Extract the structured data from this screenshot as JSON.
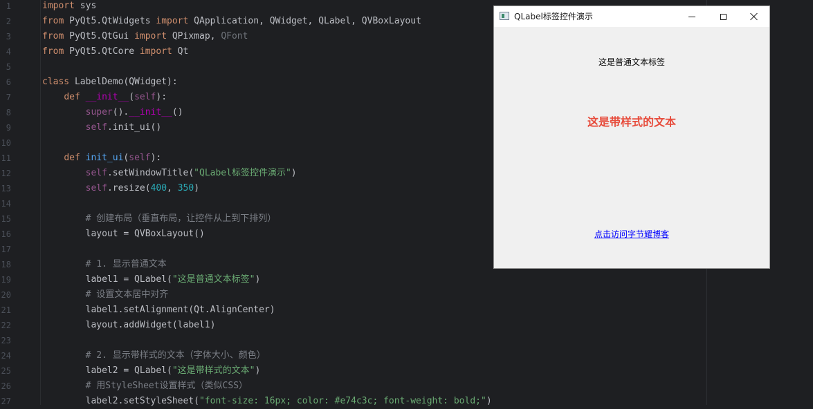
{
  "editor": {
    "lines": [
      {
        "n": "1",
        "tokens": [
          {
            "t": "import",
            "c": "kw"
          },
          {
            "t": " sys",
            "c": "plain"
          }
        ]
      },
      {
        "n": "2",
        "tokens": [
          {
            "t": "from",
            "c": "kw"
          },
          {
            "t": " PyQt5.QtWidgets ",
            "c": "plain"
          },
          {
            "t": "import",
            "c": "kw"
          },
          {
            "t": " QApplication, QWidget, QLabel, QVBoxLayout",
            "c": "plain"
          }
        ]
      },
      {
        "n": "3",
        "tokens": [
          {
            "t": "from",
            "c": "kw"
          },
          {
            "t": " PyQt5.QtGui ",
            "c": "plain"
          },
          {
            "t": "import",
            "c": "kw"
          },
          {
            "t": " QPixmap, ",
            "c": "plain"
          },
          {
            "t": "QFont",
            "c": "dim"
          }
        ]
      },
      {
        "n": "4",
        "tokens": [
          {
            "t": "from",
            "c": "kw"
          },
          {
            "t": " PyQt5.QtCore ",
            "c": "plain"
          },
          {
            "t": "import",
            "c": "kw"
          },
          {
            "t": " Qt",
            "c": "plain"
          }
        ]
      },
      {
        "n": "5",
        "tokens": []
      },
      {
        "n": "6",
        "tokens": [
          {
            "t": "class",
            "c": "kw"
          },
          {
            "t": " LabelDemo(QWidget):",
            "c": "plain"
          }
        ]
      },
      {
        "n": "7",
        "tokens": [
          {
            "t": "    ",
            "c": "plain"
          },
          {
            "t": "def",
            "c": "kw"
          },
          {
            "t": " ",
            "c": "plain"
          },
          {
            "t": "__init__",
            "c": "magic"
          },
          {
            "t": "(",
            "c": "plain"
          },
          {
            "t": "self",
            "c": "self"
          },
          {
            "t": "):",
            "c": "plain"
          }
        ]
      },
      {
        "n": "8",
        "tokens": [
          {
            "t": "        ",
            "c": "plain"
          },
          {
            "t": "super",
            "c": "self"
          },
          {
            "t": "().",
            "c": "plain"
          },
          {
            "t": "__init__",
            "c": "magic"
          },
          {
            "t": "()",
            "c": "plain"
          }
        ]
      },
      {
        "n": "9",
        "tokens": [
          {
            "t": "        ",
            "c": "plain"
          },
          {
            "t": "self",
            "c": "self"
          },
          {
            "t": ".init_ui()",
            "c": "plain"
          }
        ]
      },
      {
        "n": "10",
        "tokens": []
      },
      {
        "n": "11",
        "tokens": [
          {
            "t": "    ",
            "c": "plain"
          },
          {
            "t": "def",
            "c": "kw"
          },
          {
            "t": " ",
            "c": "plain"
          },
          {
            "t": "init_ui",
            "c": "fn"
          },
          {
            "t": "(",
            "c": "plain"
          },
          {
            "t": "self",
            "c": "self"
          },
          {
            "t": "):",
            "c": "plain"
          }
        ]
      },
      {
        "n": "12",
        "tokens": [
          {
            "t": "        ",
            "c": "plain"
          },
          {
            "t": "self",
            "c": "self"
          },
          {
            "t": ".setWindowTitle(",
            "c": "plain"
          },
          {
            "t": "\"QLabel标签控件演示\"",
            "c": "str"
          },
          {
            "t": ")",
            "c": "plain"
          }
        ]
      },
      {
        "n": "13",
        "tokens": [
          {
            "t": "        ",
            "c": "plain"
          },
          {
            "t": "self",
            "c": "self"
          },
          {
            "t": ".resize(",
            "c": "plain"
          },
          {
            "t": "400",
            "c": "num"
          },
          {
            "t": ", ",
            "c": "plain"
          },
          {
            "t": "350",
            "c": "num"
          },
          {
            "t": ")",
            "c": "plain"
          }
        ]
      },
      {
        "n": "14",
        "tokens": []
      },
      {
        "n": "15",
        "tokens": [
          {
            "t": "        ",
            "c": "plain"
          },
          {
            "t": "# 创建布局（垂直布局，让控件从上到下排列）",
            "c": "cmt"
          }
        ]
      },
      {
        "n": "16",
        "tokens": [
          {
            "t": "        layout = QVBoxLayout()",
            "c": "plain"
          }
        ]
      },
      {
        "n": "17",
        "tokens": []
      },
      {
        "n": "18",
        "tokens": [
          {
            "t": "        ",
            "c": "plain"
          },
          {
            "t": "# 1. 显示普通文本",
            "c": "cmt"
          }
        ]
      },
      {
        "n": "19",
        "tokens": [
          {
            "t": "        label1 = QLabel(",
            "c": "plain"
          },
          {
            "t": "\"这是普通文本标签\"",
            "c": "str"
          },
          {
            "t": ")",
            "c": "plain"
          }
        ]
      },
      {
        "n": "20",
        "tokens": [
          {
            "t": "        ",
            "c": "plain"
          },
          {
            "t": "# 设置文本居中对齐",
            "c": "cmt"
          }
        ]
      },
      {
        "n": "21",
        "tokens": [
          {
            "t": "        label1.setAlignment(Qt.AlignCenter)",
            "c": "plain"
          }
        ]
      },
      {
        "n": "22",
        "tokens": [
          {
            "t": "        layout.addWidget(label1)",
            "c": "plain"
          }
        ]
      },
      {
        "n": "23",
        "tokens": []
      },
      {
        "n": "24",
        "tokens": [
          {
            "t": "        ",
            "c": "plain"
          },
          {
            "t": "# 2. 显示带样式的文本（字体大小、颜色）",
            "c": "cmt"
          }
        ]
      },
      {
        "n": "25",
        "tokens": [
          {
            "t": "        label2 = QLabel(",
            "c": "plain"
          },
          {
            "t": "\"这是带样式的文本\"",
            "c": "str"
          },
          {
            "t": ")",
            "c": "plain"
          }
        ]
      },
      {
        "n": "26",
        "tokens": [
          {
            "t": "        ",
            "c": "plain"
          },
          {
            "t": "# 用StyleSheet设置样式（类似CSS）",
            "c": "cmt"
          }
        ]
      },
      {
        "n": "27",
        "tokens": [
          {
            "t": "        label2.setStyleSheet(",
            "c": "plain"
          },
          {
            "t": "\"font-size: 16px; color: #e74c3c; font-weight: bold;\"",
            "c": "str"
          },
          {
            "t": ")",
            "c": "plain"
          }
        ]
      }
    ]
  },
  "window": {
    "title": "QLabel标签控件演示",
    "icon": "app-window-icon",
    "minimize_icon": "minimize-icon",
    "maximize_icon": "maximize-icon",
    "close_icon": "close-icon",
    "label1_text": "这是普通文本标签",
    "label2_text": "这是带样式的文本",
    "label2_color": "#e74c3c",
    "link_text": "点击访问字节耀博客"
  }
}
